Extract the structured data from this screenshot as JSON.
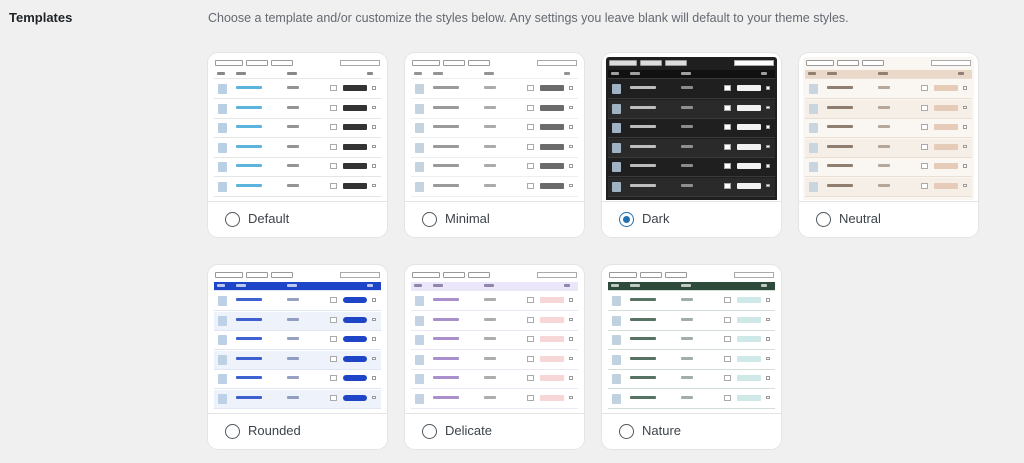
{
  "section": {
    "label": "Templates",
    "description": "Choose a template and/or customize the styles below. Any settings you leave blank will default to your theme styles."
  },
  "templates": [
    {
      "id": "default",
      "label": "Default",
      "selected": false,
      "colors": {
        "bg": "#ffffff",
        "head": "#ffffff",
        "headText": "#555555",
        "rowAlt": "#ffffff",
        "line": "#e5e5e5",
        "name": "#3fa7d6",
        "price": "#666666",
        "btn": "#333333",
        "img": "#b9cfe3"
      }
    },
    {
      "id": "minimal",
      "label": "Minimal",
      "selected": false,
      "colors": {
        "bg": "#ffffff",
        "head": "#ffffff",
        "headText": "#666666",
        "rowAlt": "#ffffff",
        "line": "#eeeeee",
        "name": "#888888",
        "price": "#888888",
        "btn": "#6b6b6b",
        "img": "#c5d3df"
      }
    },
    {
      "id": "dark",
      "label": "Dark",
      "selected": true,
      "colors": {
        "bg": "#1f1f1f",
        "head": "#111111",
        "headText": "#dddddd",
        "rowAlt": "#2a2a2a",
        "line": "#3a3a3a",
        "name": "#d8d8d8",
        "price": "#bbbbbb",
        "btn": "#f2f2f2",
        "img": "#9fb3c4"
      }
    },
    {
      "id": "neutral",
      "label": "Neutral",
      "selected": false,
      "colors": {
        "bg": "#faf6f2",
        "head": "#ead8c9",
        "headText": "#6b5a4c",
        "rowAlt": "#f6efe8",
        "line": "#eadfd5",
        "name": "#7d6a5a",
        "price": "#9a8878",
        "btn": "#e6cbb8",
        "img": "#c9d6e0"
      }
    },
    {
      "id": "rounded",
      "label": "Rounded",
      "selected": false,
      "colors": {
        "bg": "#ffffff",
        "head": "#1e45c8",
        "headText": "#ffffff",
        "rowAlt": "#eef2fb",
        "line": "#dfe5f5",
        "name": "#1e45c8",
        "price": "#6b7aa8",
        "btn": "#1e45c8",
        "img": "#bcd0e6"
      }
    },
    {
      "id": "delicate",
      "label": "Delicate",
      "selected": false,
      "colors": {
        "bg": "#ffffff",
        "head": "#ece6fa",
        "headText": "#6b5e8a",
        "rowAlt": "#ffffff",
        "line": "#ede8f6",
        "name": "#9a7cc4",
        "price": "#8a8a8a",
        "btn": "#f6d6d6",
        "img": "#c3d3e3"
      }
    },
    {
      "id": "nature",
      "label": "Nature",
      "selected": false,
      "colors": {
        "bg": "#ffffff",
        "head": "#2d4a3a",
        "headText": "#ffffff",
        "rowAlt": "#ffffff",
        "line": "#d3ded6",
        "name": "#3a5a48",
        "price": "#7a8a80",
        "btn": "#cfe8e8",
        "img": "#c0d2e0"
      }
    }
  ]
}
